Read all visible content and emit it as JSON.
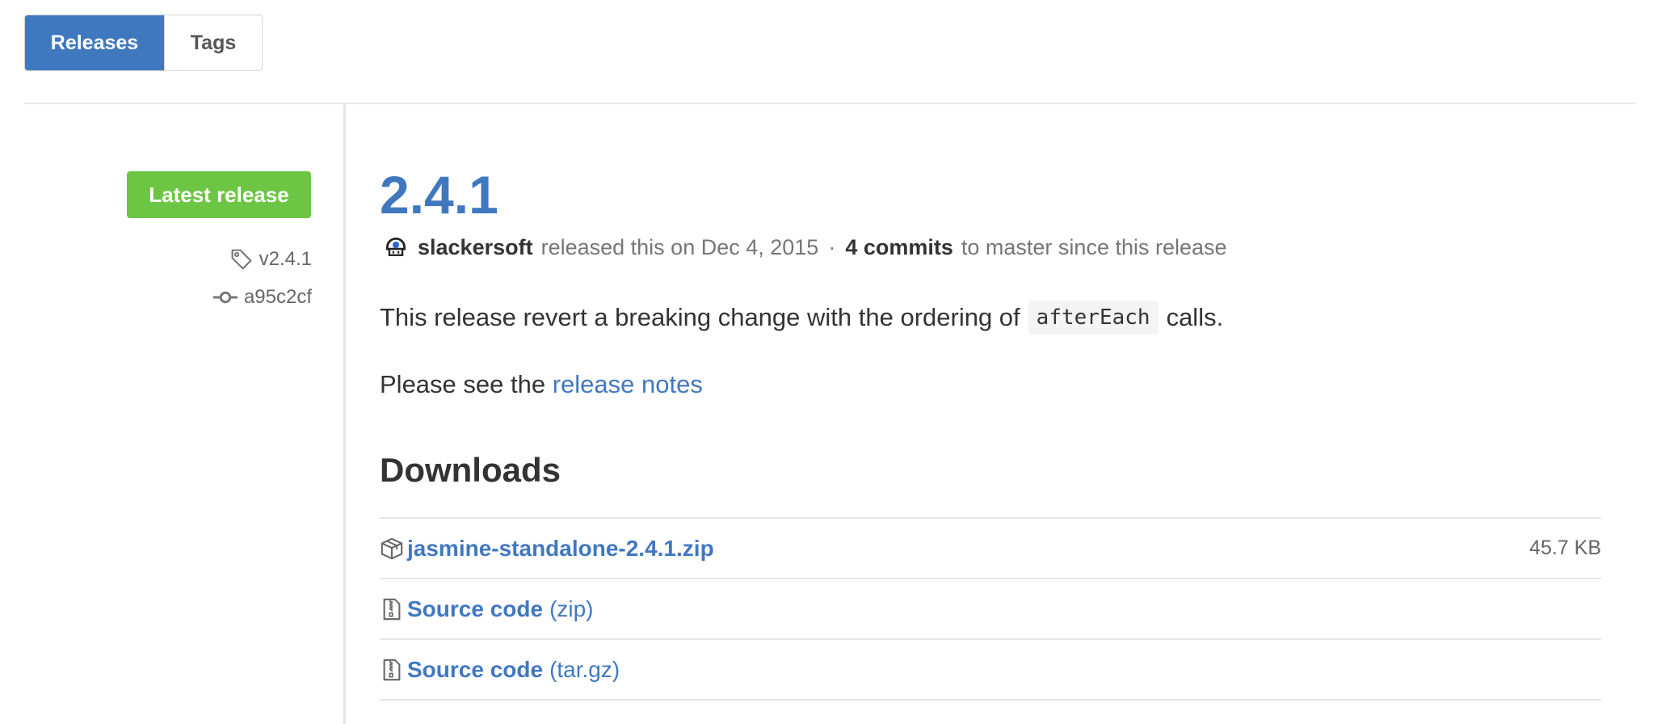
{
  "tabs": [
    {
      "label": "Releases",
      "active": true
    },
    {
      "label": "Tags",
      "active": false
    }
  ],
  "sidebar": {
    "badge": "Latest release",
    "tag": {
      "icon": "tag-icon",
      "label": "v2.4.1"
    },
    "commit": {
      "icon": "commit-icon",
      "label": "a95c2cf"
    }
  },
  "release": {
    "version": "2.4.1",
    "author": "slackersoft",
    "released_text": "released this on Dec 4, 2015",
    "separator": "·",
    "commits_count": "4 commits",
    "commits_suffix": "to master since this release",
    "description": {
      "before": "This release revert a breaking change with the ordering of",
      "code": "afterEach",
      "after": "calls."
    },
    "notes": {
      "prefix": "Please see the ",
      "link": "release notes"
    }
  },
  "downloads": {
    "heading": "Downloads",
    "items": [
      {
        "icon": "package-icon",
        "name": "jasmine-standalone-2.4.1.zip",
        "format": "",
        "size": "45.7 KB"
      },
      {
        "icon": "file-zip-icon",
        "name": "Source code",
        "format": "(zip)",
        "size": ""
      },
      {
        "icon": "file-zip-icon",
        "name": "Source code",
        "format": "(tar.gz)",
        "size": ""
      }
    ]
  },
  "colors": {
    "accent": "#4078c0",
    "badge_green": "#6cc644"
  }
}
